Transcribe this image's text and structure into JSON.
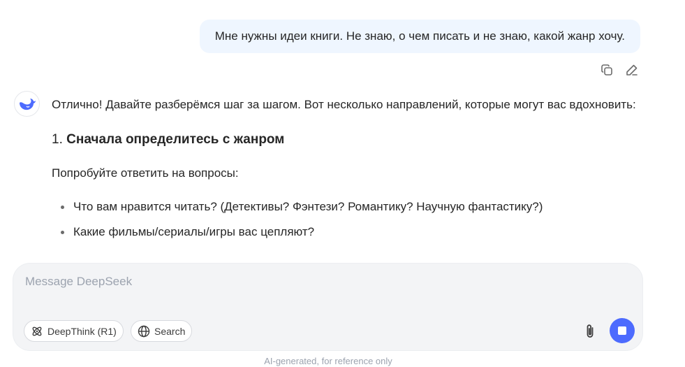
{
  "user_message": {
    "text": "Мне нужны идеи книги. Не знаю, о чем писать и не знаю, какой жанр хочу.",
    "actions": [
      {
        "icon": "copy-icon"
      },
      {
        "icon": "edit-icon"
      }
    ]
  },
  "assistant": {
    "avatar_icon": "deepseek-whale-icon",
    "intro": "Отлично! Давайте разберёмся шаг за шагом. Вот несколько направлений, которые могут вас вдохновить:",
    "section_number": "1.",
    "section_title": "Сначала определитесь с жанром",
    "question_lead": "Попробуйте ответить на вопросы:",
    "bullets": [
      "Что вам нравится читать? (Детективы? Фэнтези? Романтику? Научную фантастику?)",
      "Какие фильмы/сериалы/игры вас цепляют?"
    ]
  },
  "composer": {
    "placeholder": "Message DeepSeek",
    "deepthink_label": "DeepThink (R1)",
    "search_label": "Search",
    "attach_icon": "paperclip-icon",
    "stop_icon": "stop-icon"
  },
  "footer": {
    "note": "AI-generated, for reference only"
  },
  "colors": {
    "accent": "#4d6bfe",
    "user_bubble": "#eff6ff",
    "composer_bg": "#f3f4f6",
    "text": "#262626",
    "muted": "#9ca3af"
  }
}
